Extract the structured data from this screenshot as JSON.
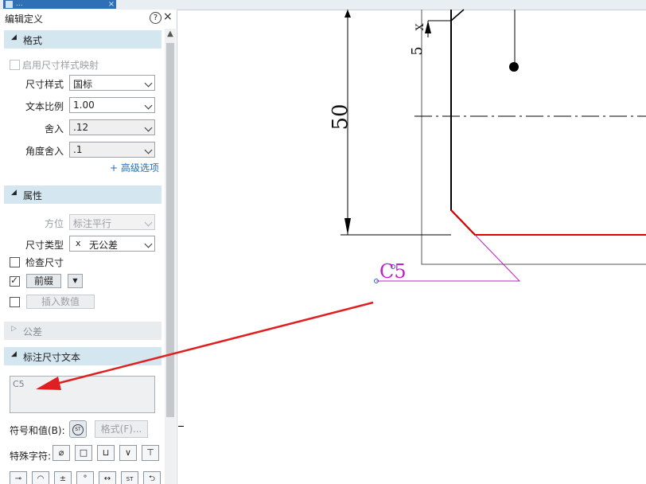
{
  "document_tab": {
    "title": "...",
    "close": "×"
  },
  "panel": {
    "title": "编辑定义",
    "help": "?",
    "close": "×",
    "format_section": {
      "title": "格式",
      "map_style_checkbox": "启用尺寸样式映射",
      "dim_style_label": "尺寸样式",
      "dim_style_value": "国标",
      "text_scale_label": "文本比例",
      "text_scale_value": "1.00",
      "round_label": "舍入",
      "round_value": ".12",
      "angle_round_label": "角度舍入",
      "angle_round_value": ".1",
      "advanced_link": "+ 高级选项"
    },
    "properties_section": {
      "title": "属性",
      "orientation_label": "方位",
      "orientation_value": "标注平行",
      "dim_type_label": "尺寸类型",
      "dim_type_icon": "x",
      "dim_type_value": "无公差",
      "inspect_label": "检查尺寸",
      "prefix_button": "前缀",
      "insert_value_button": "插入数值"
    },
    "tolerance_section": {
      "title": "公差"
    },
    "dim_text_section": {
      "title": "标注尺寸文本",
      "text_value": "C5",
      "symbols_label": "符号和值(B):",
      "format_button": "格式(F)...",
      "special_chars_label": "特殊字符:",
      "special_chars_row1": [
        "⌀",
        "□",
        "⊔",
        "∨",
        "⊤"
      ],
      "special_chars_row2": [
        "⊸",
        "◠",
        "±",
        "°",
        "↔",
        "ST",
        "⮌"
      ]
    }
  },
  "drawing": {
    "dim_50": "50",
    "dim_5": "5",
    "dim_x": "X",
    "chamfer_label": "C5",
    "colors": {
      "part_edge": "#e00000",
      "leader": "#c020c8",
      "annotation_arrow": "#e02020"
    }
  }
}
